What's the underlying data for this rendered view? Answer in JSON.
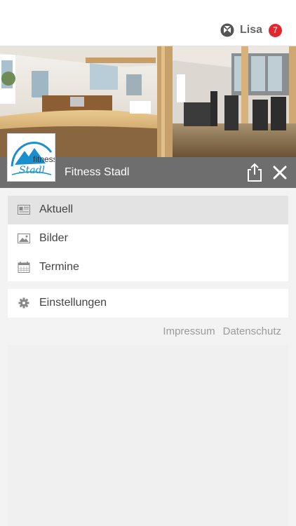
{
  "header": {
    "user_name": "Lisa",
    "notification_count": "7",
    "user_icon": "account-switch-icon"
  },
  "studio": {
    "name": "Fitness Stadl",
    "logo_text_top": "fitness",
    "logo_text_script": "Stadl"
  },
  "actions": {
    "share_icon": "share-icon",
    "close_icon": "close-icon"
  },
  "menu": {
    "items": [
      {
        "label": "Aktuell",
        "icon": "news-icon",
        "active": true
      },
      {
        "label": "Bilder",
        "icon": "image-icon",
        "active": false
      },
      {
        "label": "Termine",
        "icon": "calendar-icon",
        "active": false
      }
    ],
    "settings": {
      "label": "Einstellungen",
      "icon": "gear-icon"
    }
  },
  "footer": {
    "impressum": "Impressum",
    "datenschutz": "Datenschutz"
  },
  "colors": {
    "badge": "#e3262c",
    "titlebar": "#6e6e6e",
    "active_item": "#e3e3e3",
    "logo_blue": "#1a8fd0"
  }
}
